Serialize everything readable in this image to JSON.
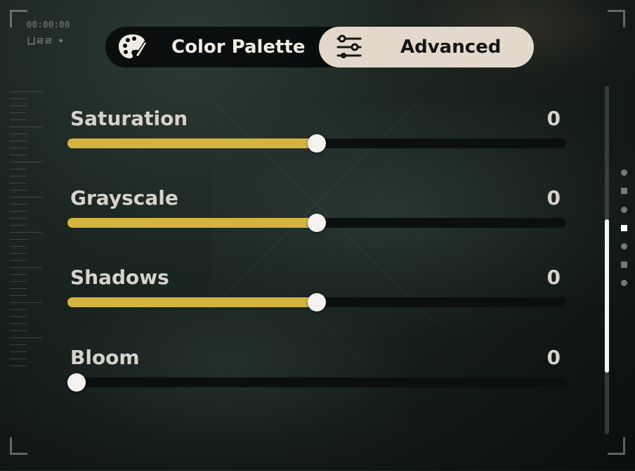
{
  "hud": {
    "timecode": "00:00:00",
    "rec_label": "ㄩㄹㄹ •"
  },
  "tabs": [
    {
      "label": "Color Palette",
      "icon": "palette-icon",
      "active": false
    },
    {
      "label": "Advanced",
      "icon": "sliders-icon",
      "active": true
    }
  ],
  "sliders": [
    {
      "label": "Saturation",
      "value": "0",
      "position": 0.5
    },
    {
      "label": "Grayscale",
      "value": "0",
      "position": 0.5
    },
    {
      "label": "Shadows",
      "value": "0",
      "position": 0.5
    },
    {
      "label": "Bloom",
      "value": "0",
      "position": 0.0
    }
  ],
  "scroll": {
    "thumb_fraction": 0.44
  },
  "colors": {
    "slider_fill": "#d4b43f",
    "active_tab_bg": "#e2d9cc",
    "knob": "#f4f2ee"
  }
}
